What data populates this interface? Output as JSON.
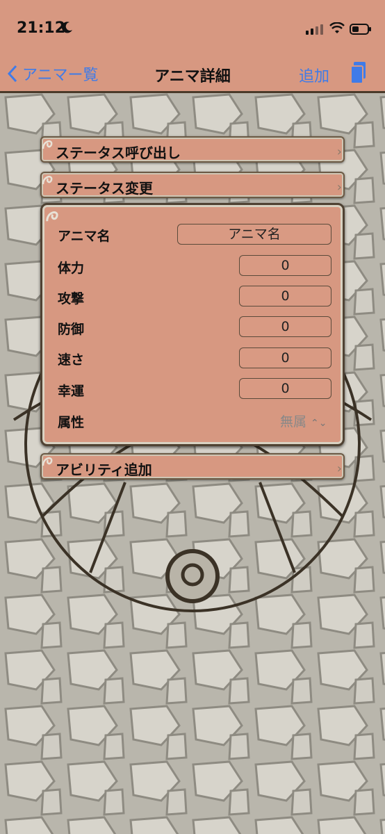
{
  "status_bar": {
    "time": "21:12"
  },
  "nav": {
    "back_label": "アニマー覧",
    "title": "アニマ詳細",
    "add_label": "追加"
  },
  "menu": {
    "status_call": "ステータス呼び出し",
    "status_change": "ステータス変更",
    "ability_add": "アビリティ追加"
  },
  "form": {
    "name_label": "アニマ名",
    "name_placeholder": "アニマ名",
    "stats": [
      {
        "label": "体力",
        "value": "0"
      },
      {
        "label": "攻撃",
        "value": "0"
      },
      {
        "label": "防御",
        "value": "0"
      },
      {
        "label": "速さ",
        "value": "0"
      },
      {
        "label": "幸運",
        "value": "0"
      }
    ],
    "attribute_label": "属性",
    "attribute_value": "無属"
  },
  "colors": {
    "accent": "#3f7be8",
    "cell_bg": "#d79881"
  }
}
